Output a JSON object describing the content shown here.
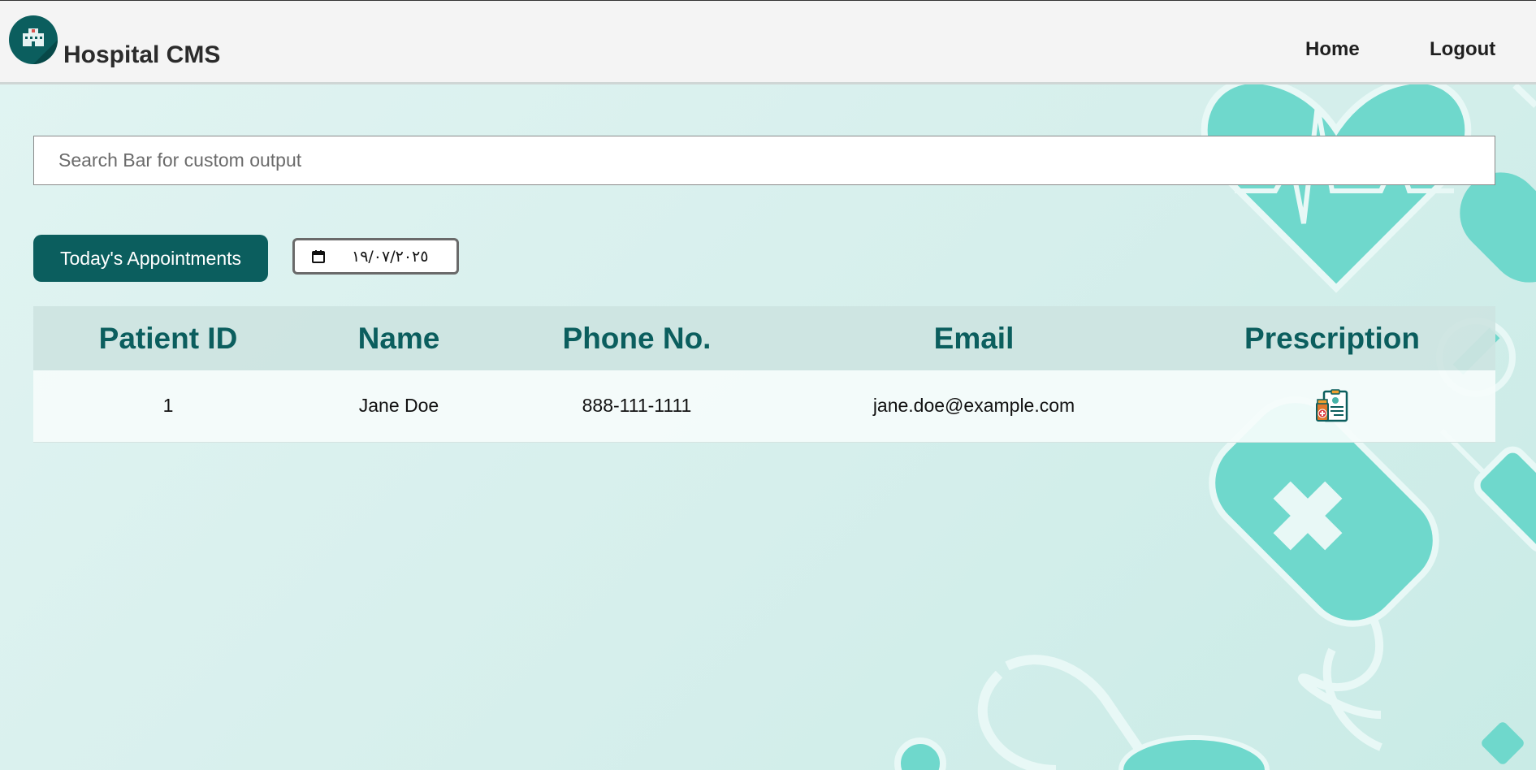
{
  "header": {
    "brand": "Hospital CMS",
    "logo_icon": "hospital-building-icon",
    "nav": [
      {
        "label": "Home"
      },
      {
        "label": "Logout"
      }
    ]
  },
  "search": {
    "placeholder": "Search Bar for custom output",
    "value": ""
  },
  "controls": {
    "today_button": "Today's Appointments",
    "date_icon": "calendar-icon",
    "date_value": "١٩/٠٧/٢٠٢٥"
  },
  "table": {
    "headers": [
      "Patient ID",
      "Name",
      "Phone No.",
      "Email",
      "Prescription"
    ],
    "rows": [
      {
        "id": "1",
        "name": "Jane Doe",
        "phone": "888-111-1111",
        "email": "jane.doe@example.com",
        "prescription_icon": "prescription-icon"
      }
    ]
  },
  "colors": {
    "accent": "#0b5e5e",
    "navbar_bg": "#f4f4f4",
    "page_bg": "#dcf1ee",
    "decor": "#6fd8cc"
  }
}
